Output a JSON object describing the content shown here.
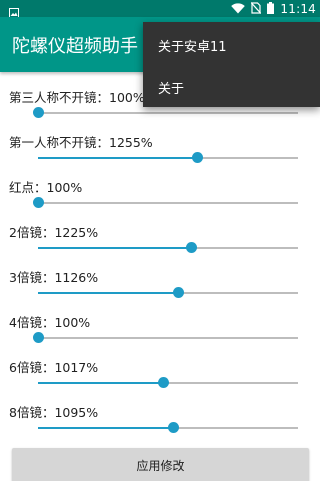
{
  "status_bar": {
    "time": "11:14",
    "icons": [
      "image-icon",
      "wifi-icon",
      "no-sim-icon",
      "battery-icon"
    ]
  },
  "app_bar": {
    "title": "陀螺仪超频助手"
  },
  "menu": {
    "items": [
      {
        "label": "关于安卓11"
      },
      {
        "label": "关于"
      }
    ]
  },
  "settings": [
    {
      "label": "第三人称不开镜：100%",
      "fraction": 0.0
    },
    {
      "label": "第一人称不开镜：1255%",
      "fraction": 0.61
    },
    {
      "label": "红点：100%",
      "fraction": 0.0
    },
    {
      "label": "2倍镜：1225%",
      "fraction": 0.59
    },
    {
      "label": "3倍镜：1126%",
      "fraction": 0.54
    },
    {
      "label": "4倍镜：100%",
      "fraction": 0.0
    },
    {
      "label": "6倍镜：1017%",
      "fraction": 0.48
    },
    {
      "label": "8倍镜：1095%",
      "fraction": 0.52
    }
  ],
  "apply_button": {
    "label": "应用修改"
  },
  "colors": {
    "status_bar": "#00796b",
    "app_bar": "#009688",
    "accent": "#1e9bc6",
    "menu_bg": "#333333"
  }
}
